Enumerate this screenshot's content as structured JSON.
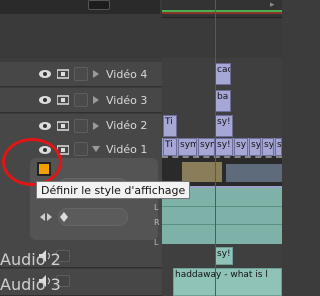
{
  "tracks": {
    "video4": {
      "name": "Vidéo 4",
      "clip": "cac"
    },
    "video3": {
      "name": "Vidéo 3",
      "clip": "ba"
    },
    "video2": {
      "name": "Vidéo 2",
      "clips": [
        "Ti",
        "sy!"
      ]
    },
    "video1": {
      "name": "Vidéo 1",
      "clips": [
        "Ti",
        "sym",
        "sym",
        "sy!",
        "sy",
        "sy",
        "sy",
        "sy"
      ]
    },
    "audio2": {
      "name": "Audio 2",
      "clip": "sy!"
    },
    "audio3": {
      "name": "Audio 3",
      "clip": "haddaway - what is l"
    }
  },
  "tooltip": "Définir le style d'affichage",
  "sub_labels": {
    "l1": "L",
    "r1": "R",
    "l2": "L",
    "r2": "R"
  },
  "colors": {
    "playhead": "#e02020",
    "annotation_circle": "#e01616",
    "video_clip": "#a7a7d6",
    "audio_clip": "#8fc3b8",
    "style_icon": "#f0a000"
  }
}
